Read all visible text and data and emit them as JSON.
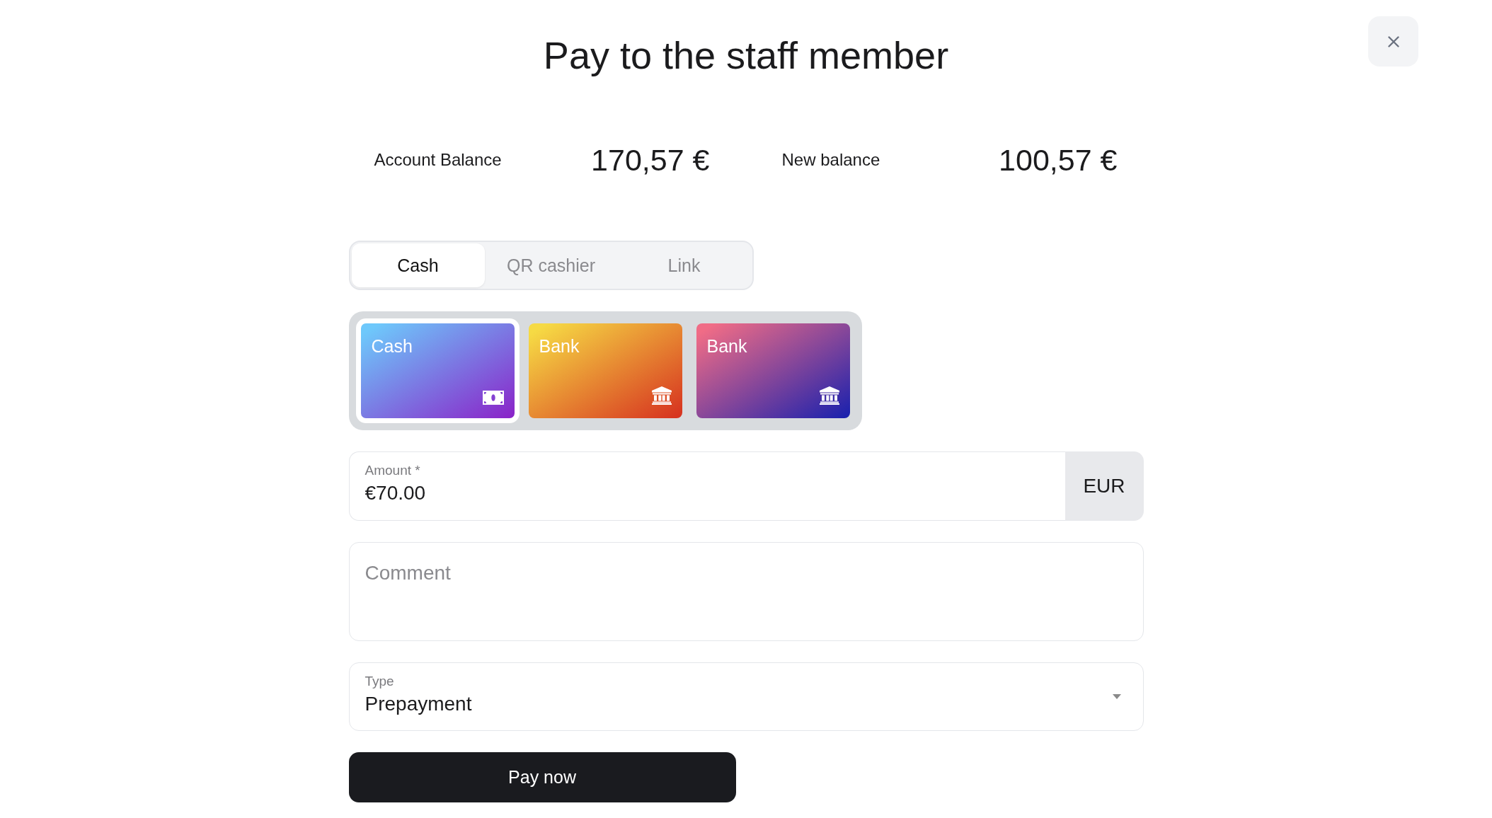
{
  "dialog": {
    "title": "Pay to the staff member"
  },
  "balances": [
    {
      "label": "Account Balance",
      "value": "170,57 €"
    },
    {
      "label": "New balance",
      "value": "100,57 €"
    }
  ],
  "tabs": [
    {
      "label": "Cash",
      "selected": true
    },
    {
      "label": "QR cashier",
      "selected": false
    },
    {
      "label": "Link",
      "selected": false
    }
  ],
  "accounts": [
    {
      "label": "Cash",
      "kind": "cash",
      "selected": true,
      "color": "#6ec8fb"
    },
    {
      "label": "Bank",
      "kind": "bank",
      "selected": false,
      "color": "#f6da44"
    },
    {
      "label": "Bank",
      "kind": "bank",
      "selected": false,
      "color": "#f06c86"
    }
  ],
  "amount": {
    "label": "Amount *",
    "value": "€70.00",
    "currency": "EUR"
  },
  "comment": {
    "placeholder": "Comment"
  },
  "type": {
    "label": "Type",
    "value": "Prepayment"
  },
  "pay_button": {
    "label": "Pay now"
  }
}
